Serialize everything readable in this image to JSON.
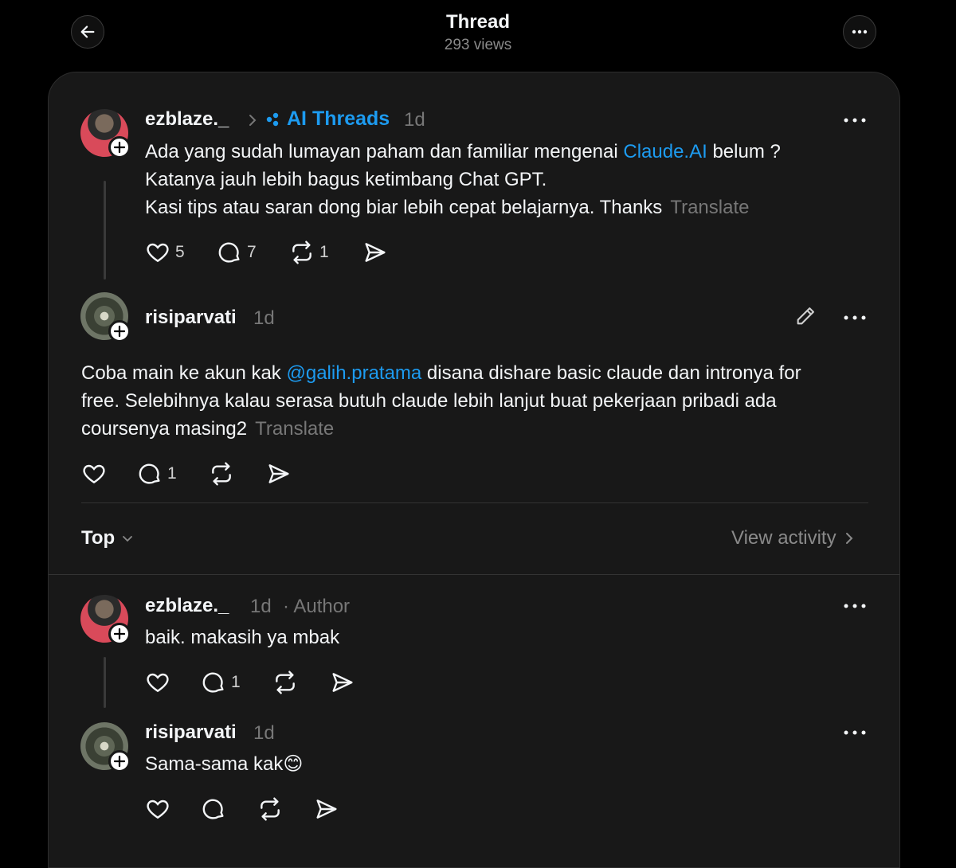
{
  "header": {
    "title": "Thread",
    "views": "293 views"
  },
  "post": {
    "username": "ezblaze._",
    "topic": "AI Threads",
    "time": "1d",
    "text_before_link": "Ada yang sudah lumayan paham dan familiar mengenai ",
    "link": "Claude.AI",
    "text_after_link": " belum ?",
    "line2": "Katanya jauh lebih bagus ketimbang Chat GPT.",
    "line3": "Kasi tips atau saran dong biar lebih cepat belajarnya. Thanks",
    "translate": "Translate",
    "likes": "5",
    "replies": "7",
    "reposts": "1"
  },
  "reply_main": {
    "username": "risiparvati",
    "time": "1d",
    "text_before_mention": "Coba main ke akun kak ",
    "mention": "@galih.pratama",
    "text_after_mention": " disana dishare basic claude dan intronya for",
    "line2": "free. Selebihnya kalau serasa butuh claude lebih lanjut buat pekerjaan pribadi ada",
    "line3": "coursenya masing2",
    "translate": "Translate",
    "replies": "1"
  },
  "sort": {
    "label": "Top",
    "view_activity": "View activity"
  },
  "comments": [
    {
      "username": "ezblaze._",
      "time": "1d",
      "badge": "· Author",
      "text": "baik. makasih ya mbak",
      "replies": "1"
    },
    {
      "username": "risiparvati",
      "time": "1d",
      "text": "Sama-sama kak😊"
    }
  ],
  "icons": {
    "back": "arrow-left-icon",
    "more": "more-horizontal-icon",
    "like": "heart-icon",
    "reply": "comment-bubble-icon",
    "repost": "repost-icon",
    "share": "send-icon",
    "edit": "pencil-icon",
    "chevron": "chevron-right-icon"
  },
  "colors": {
    "background": "#000000",
    "card": "#181818",
    "link": "#1d9bf0",
    "muted": "#777777",
    "text": "#f3f5f7"
  }
}
